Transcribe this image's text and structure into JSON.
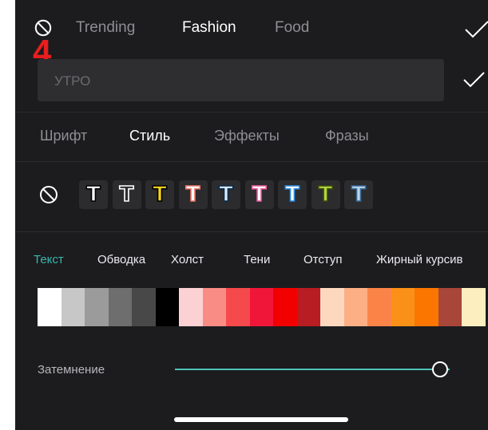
{
  "top_tabs": [
    {
      "label": "Trending",
      "active": false
    },
    {
      "label": "Fashion",
      "active": true
    },
    {
      "label": "Food",
      "active": false
    }
  ],
  "badge": "4",
  "text_input": {
    "placeholder": "УТРО",
    "value": ""
  },
  "sub_tabs": [
    {
      "label": "Шрифт",
      "active": false
    },
    {
      "label": "Стиль",
      "active": true
    },
    {
      "label": "Эффекты",
      "active": false
    },
    {
      "label": "Фразы",
      "active": false
    }
  ],
  "style_presets": [
    {
      "glyph": "T",
      "fill": "#ffffff",
      "stroke": "#000000"
    },
    {
      "glyph": "T",
      "fill": "#2c2c2e",
      "stroke": "#ffffff"
    },
    {
      "glyph": "T",
      "fill": "#f5d41c",
      "stroke": "#000000"
    },
    {
      "glyph": "T",
      "fill": "#ffffff",
      "stroke": "#f07a6a"
    },
    {
      "glyph": "T",
      "fill": "#d9ecf8",
      "stroke": "#0a2a4a"
    },
    {
      "glyph": "T",
      "fill": "#ffffff",
      "stroke": "#f25aa0"
    },
    {
      "glyph": "T",
      "fill": "#ffffff",
      "stroke": "#2c8ee8"
    },
    {
      "glyph": "T",
      "fill": "#b4d63a",
      "stroke": "#3a4a10"
    },
    {
      "glyph": "T",
      "fill": "#bcd6ea",
      "stroke": "#3a6a98"
    }
  ],
  "property_tabs": [
    {
      "label": "Текст",
      "active": true
    },
    {
      "label": "Обводка",
      "active": false
    },
    {
      "label": "Холст",
      "active": false
    },
    {
      "label": "Тени",
      "active": false
    },
    {
      "label": "Отступ",
      "active": false
    },
    {
      "label": "Жирный курсив",
      "active": false
    }
  ],
  "palette": [
    "#ffffff",
    "#c7c7c7",
    "#9b9b9b",
    "#6e6e6e",
    "#484848",
    "#000000",
    "#fcd1d4",
    "#fa8c86",
    "#f5494c",
    "#f0163a",
    "#f20000",
    "#b71d22",
    "#fdd8bf",
    "#fcae85",
    "#fa8448",
    "#fb9018",
    "#fa7600",
    "#a8463a",
    "#fdeec0"
  ],
  "dimming": {
    "label": "Затемнение",
    "level": 1.0
  },
  "colors": {
    "panel_bg": "#1c1c1e",
    "accent": "#39b7b0",
    "badge": "#e81e1e"
  }
}
